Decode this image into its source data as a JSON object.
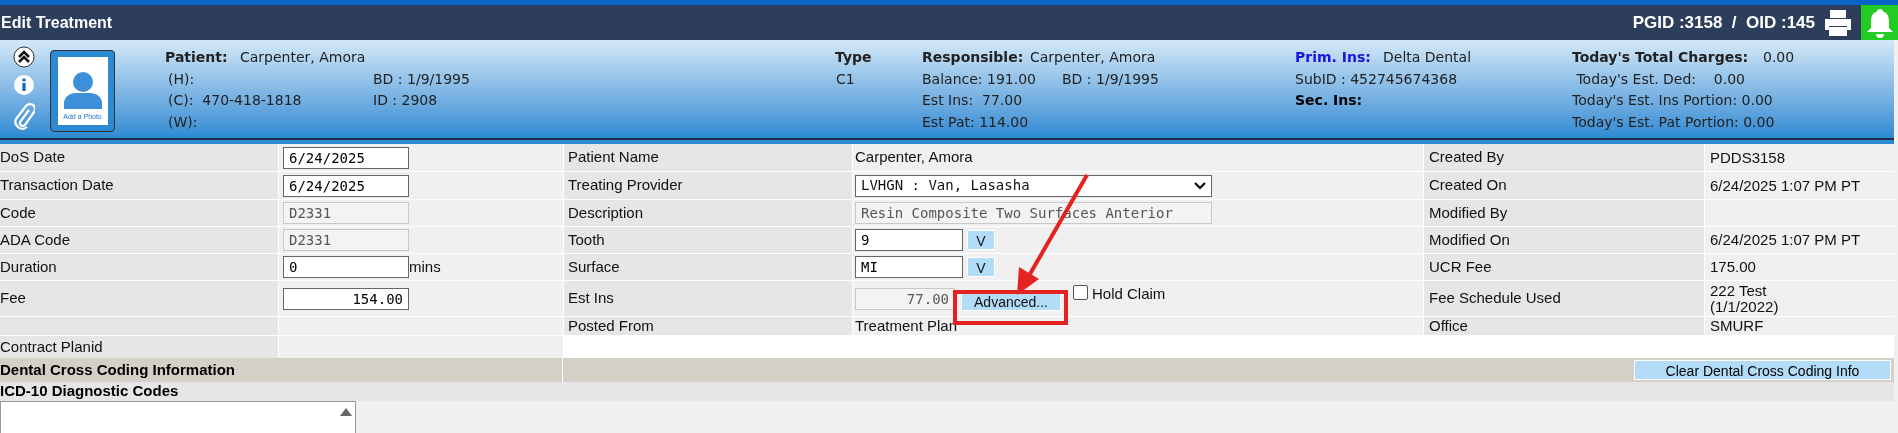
{
  "window": {
    "title": "Edit Treatment",
    "ids": "PGID :3158  /  OID :145"
  },
  "header": {
    "photo_label": "Add a Photo",
    "patient": {
      "label": "Patient:",
      "name": "Carpenter, Amora",
      "home": "(H):",
      "cell": "(C):  470-418-1818",
      "work": "(W):",
      "bd": "BD : 1/9/1995",
      "id": "ID : 2908"
    },
    "type": {
      "label": "Type",
      "value": "C1"
    },
    "responsible": {
      "label": "Responsible:",
      "name": "Carpenter, Amora",
      "balance": "Balance: 191.00",
      "bd": "BD : 1/9/1995",
      "est_ins": "Est Ins:  77.00",
      "est_pat": "Est Pat: 114.00"
    },
    "insurance": {
      "prim_label": "Prim. Ins:",
      "prim_value": "Delta Dental",
      "subid": "SubID : 452745674368",
      "sec_label": "Sec. Ins:"
    },
    "totals": {
      "label": "Today's Total Charges:",
      "value": "0.00",
      "lines": [
        " Today's Est. Ded:    0.00",
        "Today's Est. Ins Portion: 0.00",
        "Today's Est. Pat Portion: 0.00"
      ]
    }
  },
  "form": {
    "rows": [
      {
        "left": {
          "label": "DoS Date",
          "kind": "input",
          "value": "6/24/2025"
        },
        "mid": {
          "label": "Patient Name",
          "kind": "text",
          "value": "Carpenter, Amora"
        },
        "right": {
          "label": "Created By",
          "value": "PDDS3158"
        }
      },
      {
        "left": {
          "label": "Transaction Date",
          "kind": "input",
          "value": "6/24/2025"
        },
        "mid": {
          "label": "Treating Provider",
          "kind": "select",
          "value": "LVHGN : Van, Lasasha"
        },
        "right": {
          "label": "Created On",
          "value": "6/24/2025 1:07 PM PT"
        }
      },
      {
        "left": {
          "label": "Code",
          "kind": "disabled",
          "value": "D2331"
        },
        "mid": {
          "label": "Description",
          "kind": "disabled-wide",
          "value": "Resin Composite Two Surfaces Anterior"
        },
        "right": {
          "label": "Modified By"
        }
      },
      {
        "left": {
          "label": "ADA Code",
          "kind": "disabled",
          "value": "D2331"
        },
        "mid": {
          "label": "Tooth",
          "kind": "lookup",
          "value": "9",
          "button": "V"
        },
        "right": {
          "label": "Modified On",
          "value": "6/24/2025 1:07 PM PT"
        }
      },
      {
        "left": {
          "label": "Duration",
          "kind": "input",
          "value": "0",
          "suffix": "mins"
        },
        "mid": {
          "label": "Surface",
          "kind": "lookup",
          "value": "MI",
          "button": "V"
        },
        "right": {
          "label": "UCR Fee",
          "value": "175.00"
        }
      },
      {
        "left": {
          "label": "Fee",
          "kind": "amount",
          "value": "154.00"
        },
        "mid": {
          "label": "Est Ins",
          "kind": "est-ins",
          "value": "77.00",
          "button": "Advanced...",
          "checkbox": {
            "label": "Hold Claim",
            "checked": false
          }
        },
        "right": {
          "label": "Fee Schedule Used",
          "value": "222 Test\n(1/1/2022)"
        }
      },
      {
        "left": {
          "kind": "empty"
        },
        "mid": {
          "label": "Posted From",
          "kind": "text",
          "value": "Treatment Plan"
        },
        "right": {
          "label": "Office",
          "value": "SMURF"
        }
      },
      {
        "left": {
          "label": "Contract Planid",
          "kind": "empty"
        }
      }
    ]
  },
  "cross_coding": {
    "title": "Dental Cross Coding Information",
    "clear_button": "Clear Dental Cross Coding Info"
  },
  "icd10": {
    "title": "ICD-10 Diagnostic Codes"
  }
}
